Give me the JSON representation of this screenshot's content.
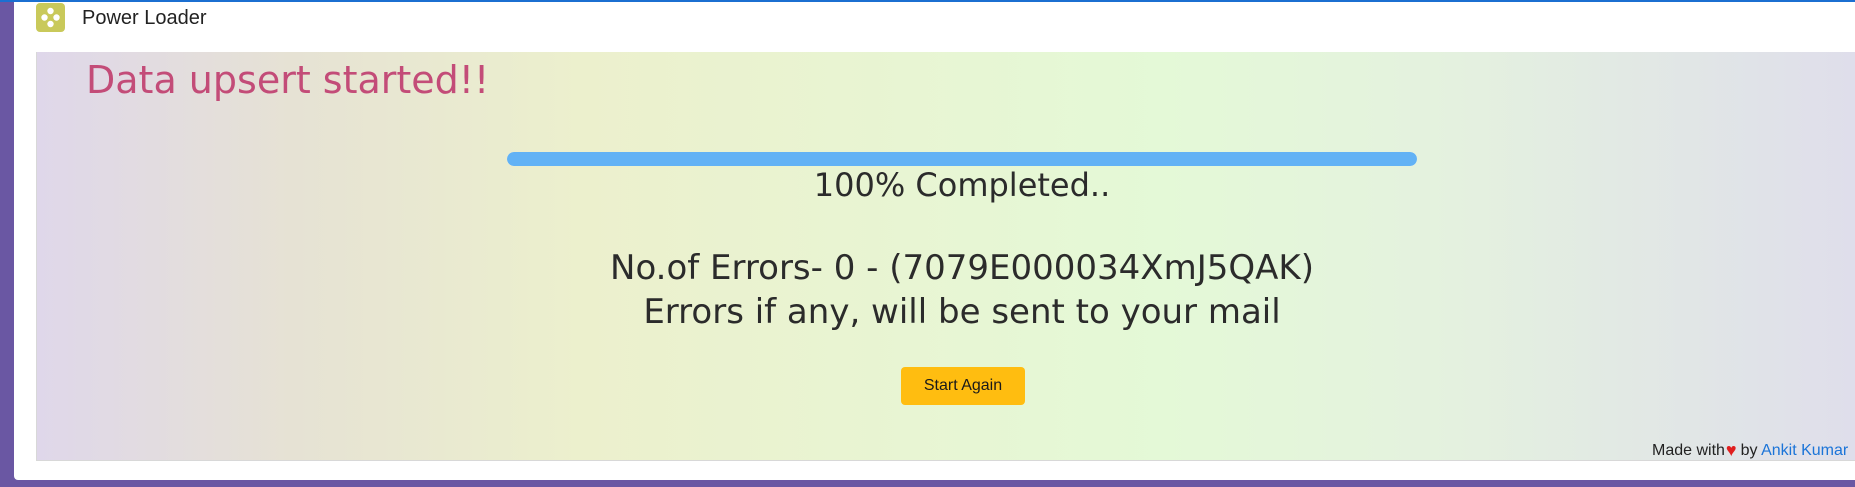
{
  "app": {
    "title": "Power Loader",
    "logo_icon": "app-logo-icon"
  },
  "status": {
    "headline": "Data upsert started!!",
    "progress_percent": 100,
    "progress_label": "100% Completed..",
    "error_count_text": "No.of Errors- 0 - (7079E000034XmJ5QAK)",
    "error_note": "Errors if any, will be sent to your mail"
  },
  "actions": {
    "start_again_label": "Start Again"
  },
  "footer": {
    "made_with": "Made with",
    "heart_glyph": "♥",
    "by": "by",
    "author": "Ankit Kumar"
  },
  "colors": {
    "headline": "#c34c78",
    "progress_fill": "#62b2f5",
    "button": "#ffbd10",
    "window_background": "#6a57a3",
    "link": "#1b74d8",
    "heart": "#e01e1e"
  }
}
